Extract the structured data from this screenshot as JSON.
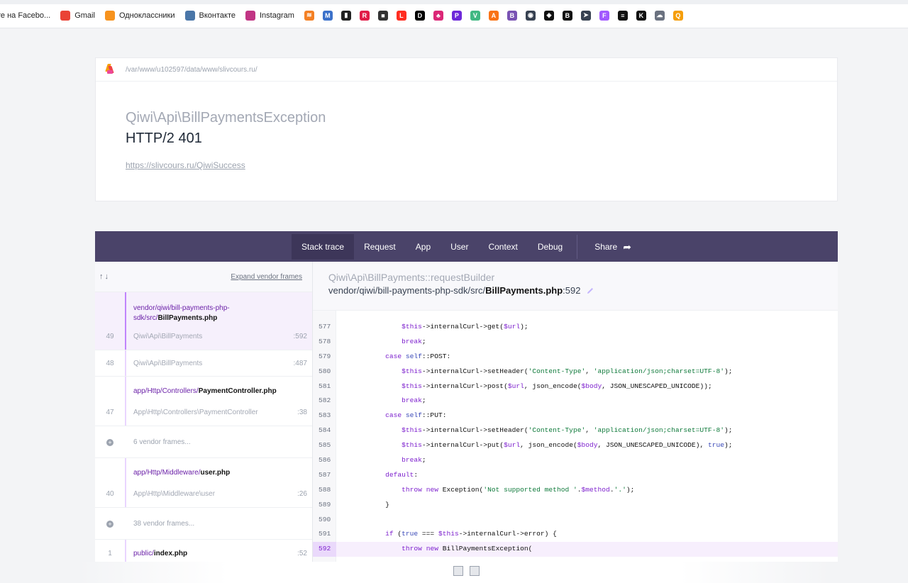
{
  "bookmarks": [
    {
      "label": "те на Facebo...",
      "icon": "facebook-icon",
      "color": "#1877f2"
    },
    {
      "label": "Gmail",
      "icon": "gmail-icon",
      "color": "#ea4335"
    },
    {
      "label": "Одноклассники",
      "icon": "ok-icon",
      "color": "#f7931e"
    },
    {
      "label": "Вконтакте",
      "icon": "vk-icon",
      "color": "#4a76a8"
    },
    {
      "label": "Instagram",
      "icon": "instagram-icon",
      "color": "#c13584"
    }
  ],
  "bookmark_icons": [
    {
      "icon": "stackoverflow-icon",
      "color": "#f48024",
      "glyph": "≋"
    },
    {
      "icon": "mdb-icon",
      "color": "#3b71ca",
      "glyph": "M"
    },
    {
      "icon": "bookmark-icon",
      "color": "#222222",
      "glyph": "▮"
    },
    {
      "icon": "repo-icon",
      "color": "#e11d48",
      "glyph": "R"
    },
    {
      "icon": "square-icon",
      "color": "#333333",
      "glyph": "■"
    },
    {
      "icon": "laravel-icon",
      "color": "#ff2d20",
      "glyph": "L"
    },
    {
      "icon": "dev-icon",
      "color": "#000000",
      "glyph": "D"
    },
    {
      "icon": "hat-icon",
      "color": "#db2777",
      "glyph": "♣"
    },
    {
      "icon": "php-icon",
      "color": "#6d28d9",
      "glyph": "P"
    },
    {
      "icon": "vue-icon",
      "color": "#41b883",
      "glyph": "V"
    },
    {
      "icon": "ai-icon",
      "color": "#f97316",
      "glyph": "A"
    },
    {
      "icon": "bootstrap-icon",
      "color": "#7952b3",
      "glyph": "B"
    },
    {
      "icon": "globe-icon",
      "color": "#374151",
      "glyph": "◉"
    },
    {
      "icon": "codepen-icon",
      "color": "#111111",
      "glyph": "◈"
    },
    {
      "icon": "bc-icon",
      "color": "#111111",
      "glyph": "B"
    },
    {
      "icon": "telegram-icon",
      "color": "#374151",
      "glyph": "➤"
    },
    {
      "icon": "figma-icon",
      "color": "#a259ff",
      "glyph": "F"
    },
    {
      "icon": "stack-icon",
      "color": "#111111",
      "glyph": "≡"
    },
    {
      "icon": "kodi-icon",
      "color": "#111111",
      "glyph": "K"
    },
    {
      "icon": "chat-icon",
      "color": "#6b7280",
      "glyph": "☁"
    },
    {
      "icon": "search-circle-icon",
      "color": "#f59e0b",
      "glyph": "Q"
    }
  ],
  "header": {
    "path": "/var/www/u102597/data/www/slivcours.ru/",
    "exception_class": "Qiwi\\Api\\BillPaymentsException",
    "exception_message": "HTTP/2 401",
    "url": "https://slivcours.ru/QiwiSuccess"
  },
  "tabs": [
    {
      "label": "Stack trace",
      "active": true
    },
    {
      "label": "Request"
    },
    {
      "label": "App"
    },
    {
      "label": "User"
    },
    {
      "label": "Context"
    },
    {
      "label": "Debug"
    }
  ],
  "share_label": "Share",
  "frames_panel": {
    "sort_icons": "↑↓",
    "expand_label": "Expand vendor frames"
  },
  "frames": [
    {
      "num": "49",
      "file_prefix": "vendor/qiwi/bill-payments-php-sdk/src/",
      "file_bold": "BillPayments.php",
      "cls": "Qiwi\\Api\\BillPayments",
      "line": ":592",
      "selected": true
    },
    {
      "num": "48",
      "cls": "Qiwi\\Api\\BillPayments",
      "line": ":487"
    },
    {
      "num": "47",
      "file_prefix": "app/Http/Controllers/",
      "file_bold": "PaymentController.php",
      "cls": "App\\Http\\Controllers\\PaymentController",
      "line": ":38"
    },
    {
      "collapsed": "6 vendor frames..."
    },
    {
      "num": "40",
      "file_prefix": "app/Http/Middleware/",
      "file_bold": "user.php",
      "cls": "App\\Http\\Middleware\\user",
      "line": ":26"
    },
    {
      "collapsed": "38 vendor frames..."
    },
    {
      "num": "1",
      "file_prefix": "public/",
      "file_bold": "index.php",
      "line": ":52"
    }
  ],
  "code": {
    "class_name": "Qiwi\\Api\\BillPayments",
    "method_sep": "::",
    "method": "requestBuilder",
    "file_prefix": "vendor/qiwi/bill-payments-php-sdk/src/",
    "file_bold": "BillPayments.php",
    "file_line": ":592",
    "lines": [
      {
        "no": "577",
        "text": "                $this->internalCurl->get($url);"
      },
      {
        "no": "578",
        "text": "                break;"
      },
      {
        "no": "579",
        "text": "            case self::POST:"
      },
      {
        "no": "580",
        "text": "                $this->internalCurl->setHeader('Content-Type', 'application/json;charset=UTF-8');"
      },
      {
        "no": "581",
        "text": "                $this->internalCurl->post($url, json_encode($body, JSON_UNESCAPED_UNICODE));"
      },
      {
        "no": "582",
        "text": "                break;"
      },
      {
        "no": "583",
        "text": "            case self::PUT:"
      },
      {
        "no": "584",
        "text": "                $this->internalCurl->setHeader('Content-Type', 'application/json;charset=UTF-8');"
      },
      {
        "no": "585",
        "text": "                $this->internalCurl->put($url, json_encode($body, JSON_UNESCAPED_UNICODE), true);"
      },
      {
        "no": "586",
        "text": "                break;"
      },
      {
        "no": "587",
        "text": "            default:"
      },
      {
        "no": "588",
        "text": "                throw new Exception('Not supported method '.$method.'.');"
      },
      {
        "no": "589",
        "text": "            }"
      },
      {
        "no": "590",
        "text": ""
      },
      {
        "no": "591",
        "text": "            if (true === $this->internalCurl->error) {"
      },
      {
        "no": "592",
        "text": "                throw new BillPaymentsException(",
        "highlight": true
      }
    ]
  }
}
